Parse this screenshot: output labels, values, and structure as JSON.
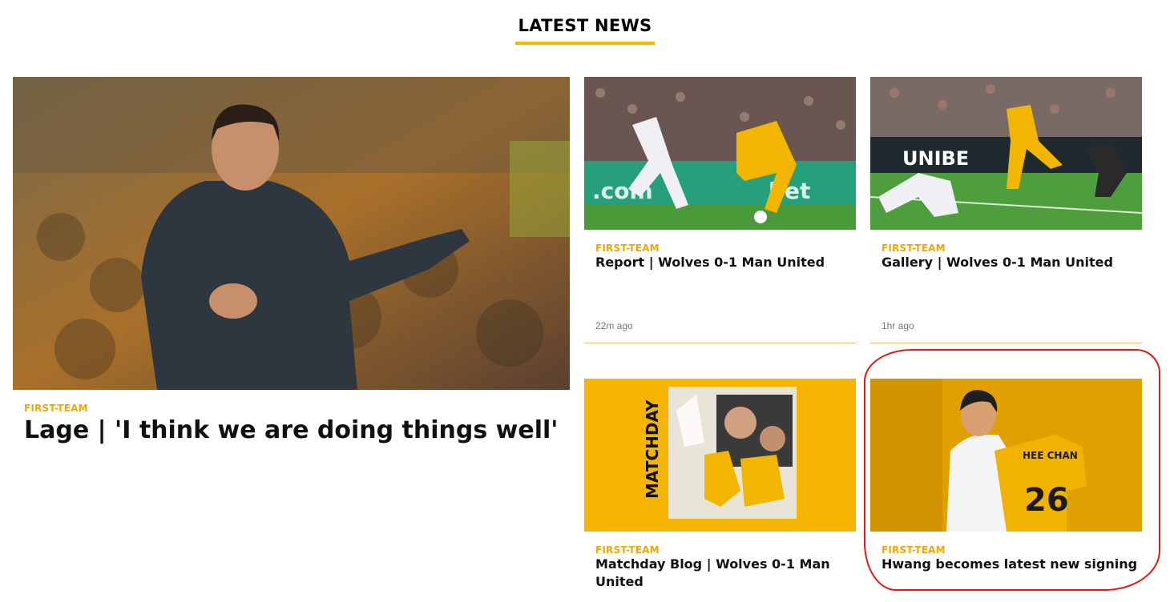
{
  "section": {
    "title": "LATEST NEWS"
  },
  "articles": [
    {
      "category": "FIRST-TEAM",
      "headline": "Lage | 'I think we are doing things well'",
      "image": "manager-touchline-photo"
    },
    {
      "category": "FIRST-TEAM",
      "headline": "Report | Wolves 0-1 Man United",
      "time": "22m ago",
      "image": "match-action-photo"
    },
    {
      "category": "FIRST-TEAM",
      "headline": "Gallery | Wolves 0-1 Man United",
      "time": "1hr ago",
      "image": "goalmouth-action-photo"
    },
    {
      "category": "FIRST-TEAM",
      "headline": "Matchday Blog | Wolves 0-1 Man United",
      "image": "matchday-graphic"
    },
    {
      "category": "FIRST-TEAM",
      "headline": "Hwang becomes latest new signing",
      "image": "new-signing-shirt-photo"
    }
  ],
  "colors": {
    "accent": "#f5b800",
    "category": "#f0a800",
    "annotation": "#e01818"
  }
}
